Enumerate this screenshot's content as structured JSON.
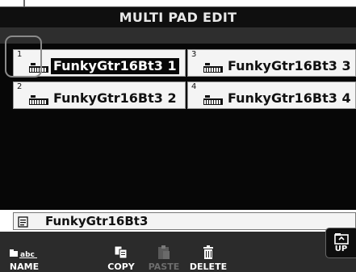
{
  "window": {
    "title": "MULTI PAD EDIT"
  },
  "pads": [
    {
      "number": "1",
      "name": "FunkyGtr16Bt3 1",
      "selected": true
    },
    {
      "number": "3",
      "name": "FunkyGtr16Bt3 3",
      "selected": false
    },
    {
      "number": "2",
      "name": "FunkyGtr16Bt3 2",
      "selected": false
    },
    {
      "number": "4",
      "name": "FunkyGtr16Bt3 4",
      "selected": false
    }
  ],
  "pad_icon": "keyboard-pad-icon",
  "file": {
    "icon": "file-document-icon",
    "name": "FunkyGtr16Bt3"
  },
  "buttons": {
    "name": {
      "label": "NAME",
      "icon": "folder-abc-icon"
    },
    "copy": {
      "label": "COPY",
      "icon": "copy-icon"
    },
    "paste": {
      "label": "PASTE",
      "icon": "paste-icon",
      "enabled": false
    },
    "delete": {
      "label": "DELETE",
      "icon": "trash-icon"
    },
    "up": {
      "label": "UP",
      "icon": "folder-up-icon"
    }
  },
  "colors": {
    "background": "#070707",
    "pad": "#f4f4f4",
    "selected_text_bg": "#080808",
    "bar": "#2b2b2b"
  }
}
